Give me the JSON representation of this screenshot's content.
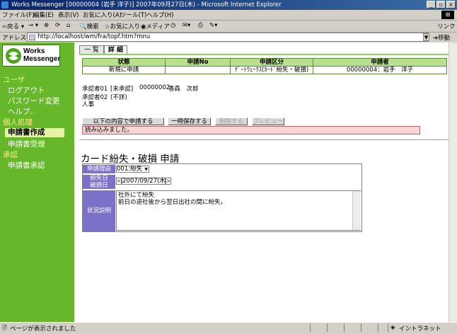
{
  "window": {
    "title": "Works Messenger [00000004 (岩手 洋子)] 2007年09月27日(木) - Microsoft Internet Explorer",
    "min_glyph": "_",
    "max_glyph": "▫",
    "close_glyph": "×"
  },
  "menu": [
    "ファイル(F)",
    "編集(E)",
    "表示(V)",
    "お気に入り(A)",
    "ツール(T)",
    "ヘルプ(H)"
  ],
  "toolbar": {
    "back": "戻る",
    "search": "検索",
    "favorites": "お気に入り",
    "media": "メディア",
    "links": "リンク »"
  },
  "address": {
    "label": "アドレス(D)",
    "url": "http://localhost/wm/fra/topf.htm?mnu",
    "go": "移動"
  },
  "logo": {
    "line1": "Works",
    "line2": "Messenger"
  },
  "sidebar": {
    "sections": [
      {
        "title": "ユーザ",
        "items": [
          "ログアウト",
          "パスワード変更",
          "ヘルプ.."
        ]
      },
      {
        "title": "個人処理",
        "items": [
          "申請書作成",
          "申請書受理"
        ]
      },
      {
        "title": "承認",
        "items": [
          "申請書承認"
        ]
      }
    ],
    "active_item": "申請書作成"
  },
  "tabs": [
    "一 覧",
    "詳 細"
  ],
  "summary": {
    "headers": [
      "状態",
      "申請No",
      "申請区分",
      "申請者"
    ],
    "row": [
      "新規に申請",
      "",
      "ｹﾞｰﾄｳｪｰｸｽ(ｶｰﾄﾞ紛失・破損)",
      "00000004：岩手　洋子"
    ]
  },
  "approvers": [
    {
      "label": "承認者01",
      "status": "[未承認]",
      "code": "00000002",
      "name": "香森　次郎"
    },
    {
      "label": "承認者02",
      "status": "(不詳)",
      "code": "",
      "name": "人事"
    }
  ],
  "buttons": {
    "apply": "以下の内容で申請する",
    "save": "一時保存する",
    "delete": "削除する",
    "preview": "プレビュー"
  },
  "message": "読み込みました。",
  "form": {
    "title": "カード紛失・破損 申請",
    "reason_label": "申請理由",
    "reason_value": "001:紛失",
    "date_label_1": "紛失日",
    "date_label_2": "破損日",
    "date_value": "2007/09/27(木)",
    "desc_label": "状況説明",
    "desc_lines": [
      "社外にて紛失",
      "前日の退社後から翌日出社の間に紛失。"
    ]
  },
  "statusbar": {
    "text": "ページが表示されました",
    "zone": "イントラネット"
  }
}
